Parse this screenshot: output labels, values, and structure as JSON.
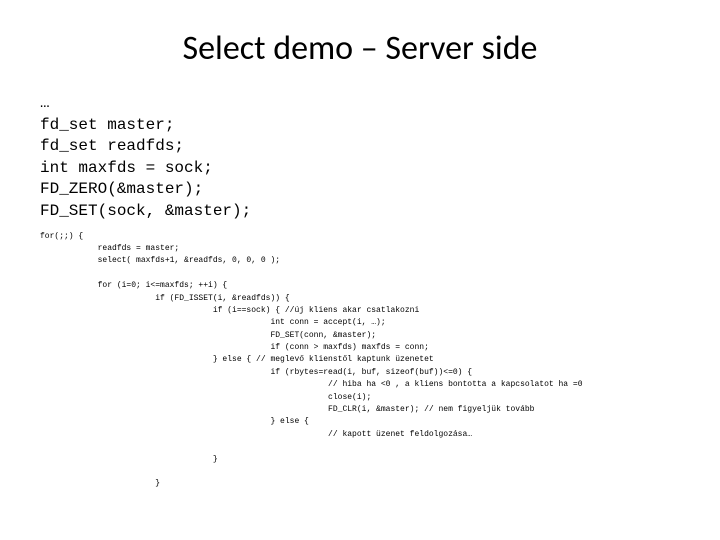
{
  "title": "Select demo – Server side",
  "code_large": "…\nfd_set master;\nfd_set readfds;\nint maxfds = sock;\nFD_ZERO(&master);\nFD_SET(sock, &master);",
  "code_small": "for(;;) {\n            readfds = master;\n            select( maxfds+1, &readfds, 0, 0, 0 );\n\n            for (i=0; i<=maxfds; ++i) {\n                        if (FD_ISSET(i, &readfds)) {\n                                    if (i==sock) { //új kliens akar csatlakozni\n                                                int conn = accept(i, …);\n                                                FD_SET(conn, &master);\n                                                if (conn > maxfds) maxfds = conn;\n                                    } else { // meglevő klienstől kaptunk üzenetet\n                                                if (rbytes=read(i, buf, sizeof(buf))<=0) {\n                                                            // hiba ha <0 , a kliens bontotta a kapcsolatot ha =0\n                                                            close(i);\n                                                            FD_CLR(i, &master); // nem figyeljük tovább\n                                                } else {\n                                                            // kapott üzenet feldolgozása…\n\n                                    }\n\n                        }"
}
